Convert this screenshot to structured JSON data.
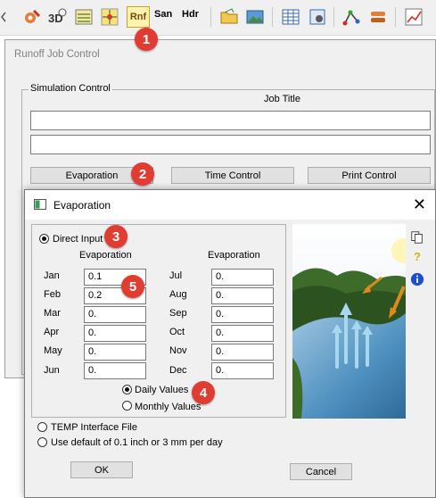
{
  "toolbar": {
    "rnf_label": "Rnf",
    "san_label": "San",
    "hdr_label": "Hdr"
  },
  "runoff_window": {
    "title": "Runoff Job Control",
    "group_title": "Simulation Control",
    "job_title_label": "Job Title",
    "job_title_line1": "",
    "job_title_line2": "",
    "buttons": {
      "evaporation": "Evaporation",
      "time_control": "Time Control",
      "print_control": "Print Control"
    }
  },
  "badges": [
    "1",
    "2",
    "3",
    "4",
    "5"
  ],
  "evaporation_dialog": {
    "title": "Evaporation",
    "options": {
      "direct_input": "Direct Input",
      "temp_file": "TEMP Interface File",
      "use_default": "Use default of 0.1 inch or 3 mm per day"
    },
    "selected_option": "direct_input",
    "column_header": "Evaporation",
    "months": [
      {
        "name": "Jan",
        "value": "0.1"
      },
      {
        "name": "Feb",
        "value": "0.2"
      },
      {
        "name": "Mar",
        "value": "0."
      },
      {
        "name": "Apr",
        "value": "0."
      },
      {
        "name": "May",
        "value": "0."
      },
      {
        "name": "Jun",
        "value": "0."
      },
      {
        "name": "Jul",
        "value": "0."
      },
      {
        "name": "Aug",
        "value": "0."
      },
      {
        "name": "Sep",
        "value": "0."
      },
      {
        "name": "Oct",
        "value": "0."
      },
      {
        "name": "Nov",
        "value": "0."
      },
      {
        "name": "Dec",
        "value": "0."
      }
    ],
    "units": {
      "daily": "Daily Values",
      "monthly": "Monthly Values",
      "selected": "daily"
    },
    "ok_label": "OK",
    "cancel_label": "Cancel"
  },
  "colors": {
    "badge": "#e03c31",
    "window_bg": "#f0f0f0",
    "water": "#3f7fb0",
    "arrow": "#e08a1e"
  }
}
